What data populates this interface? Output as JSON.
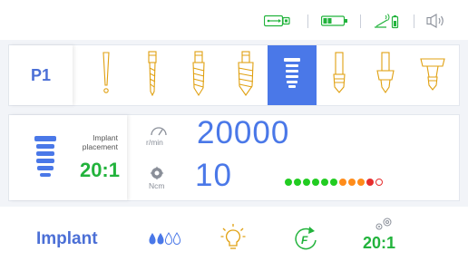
{
  "status_bar": {
    "icons": [
      "usb-icon",
      "battery-icon",
      "pedal-battery-icon",
      "speaker-icon"
    ]
  },
  "toolbar": {
    "program": "P1",
    "tools": [
      {
        "icon": "probe-icon",
        "active": false
      },
      {
        "icon": "pilot-drill-icon",
        "active": false
      },
      {
        "icon": "twist-drill-icon",
        "active": false
      },
      {
        "icon": "tap-drill-icon",
        "active": false
      },
      {
        "icon": "implant-icon",
        "active": true
      },
      {
        "icon": "cover-screw-icon",
        "active": false
      },
      {
        "icon": "healing-abutment-icon",
        "active": false
      },
      {
        "icon": "abutment-icon",
        "active": false
      }
    ]
  },
  "info": {
    "mode_name_line1": "Implant",
    "mode_name_line2": "placement",
    "ratio": "20:1",
    "speed_unit": "r/min",
    "speed_value": "20000",
    "torque_unit": "Ncm",
    "torque_value": "10",
    "torque_dots": [
      {
        "color": "#22cc22",
        "filled": true
      },
      {
        "color": "#22cc22",
        "filled": true
      },
      {
        "color": "#22cc22",
        "filled": true
      },
      {
        "color": "#22cc22",
        "filled": true
      },
      {
        "color": "#22cc22",
        "filled": true
      },
      {
        "color": "#22cc22",
        "filled": true
      },
      {
        "color": "#ff8c1a",
        "filled": true
      },
      {
        "color": "#ff8c1a",
        "filled": true
      },
      {
        "color": "#ff8c1a",
        "filled": true
      },
      {
        "color": "#e62e2e",
        "filled": true
      },
      {
        "color": "#e62e2e",
        "filled": false
      }
    ]
  },
  "bottom": {
    "mode_label": "Implant",
    "irrigation_level": "2 of 4 drops filled",
    "ratio_label": "20:1",
    "icons": [
      "irrigation-drops-icon",
      "light-bulb-icon",
      "forward-rotation-icon",
      "gear-ratio-icon"
    ]
  },
  "colors": {
    "accent_blue": "#4a78e8",
    "ratio_green": "#22b33c",
    "usb_green": "#22b33c"
  }
}
